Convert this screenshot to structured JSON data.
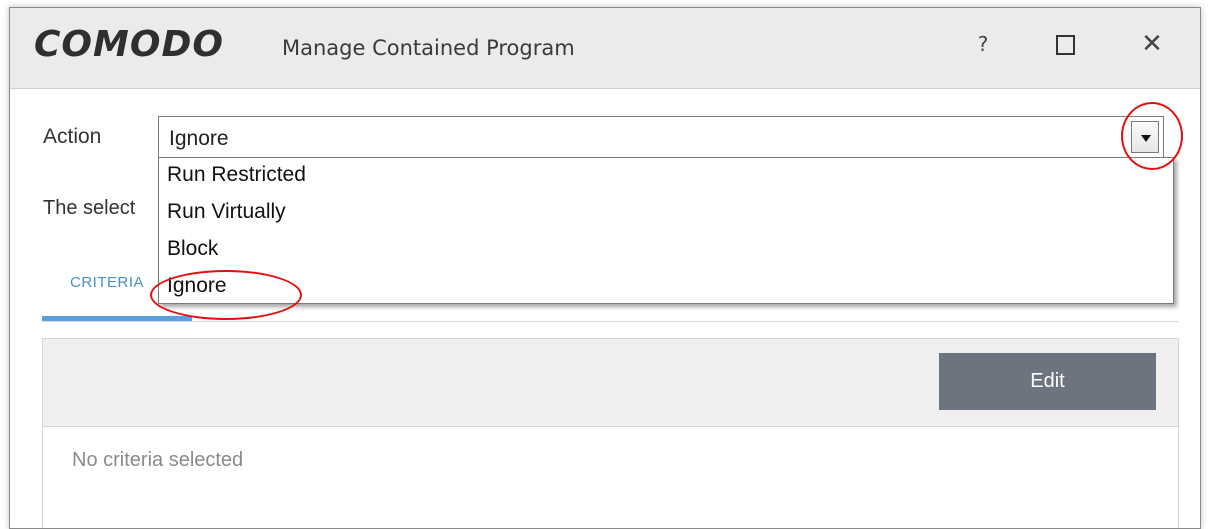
{
  "window": {
    "logo": "COMODO",
    "title": "Manage Contained Program",
    "help_label": "?",
    "close_label": "✕"
  },
  "action": {
    "label": "Action",
    "selected_value": "Ignore",
    "options": [
      "Run Restricted",
      "Run Virtually",
      "Block",
      "Ignore"
    ]
  },
  "description": {
    "text": "The select"
  },
  "tabs": [
    {
      "label": "CRITERIA",
      "active": true
    }
  ],
  "criteria_panel": {
    "edit_label": "Edit",
    "empty_text": "No criteria selected"
  },
  "annotations": {
    "highlight_color": "#e01010"
  },
  "colors": {
    "accent": "#5aa0df",
    "edit_button": "#6d7480",
    "titlebar": "#ebebeb"
  }
}
